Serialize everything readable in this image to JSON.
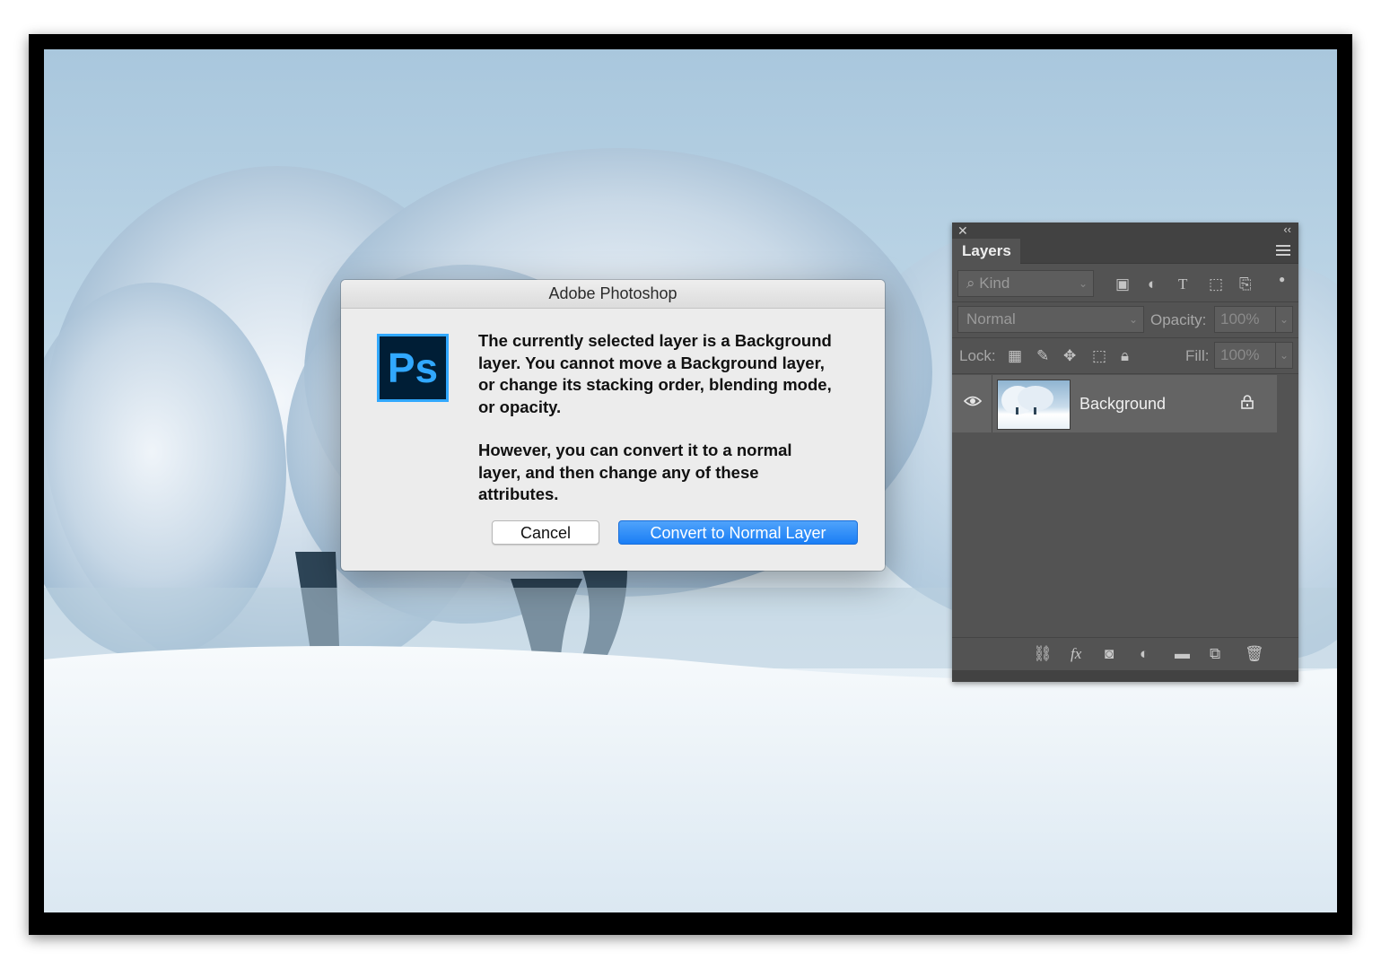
{
  "dialog": {
    "title": "Adobe Photoshop",
    "logo_text": "Ps",
    "message_1": "The currently selected layer is a Background layer. You cannot move a Background layer, or change its stacking order, blending mode, or opacity.",
    "message_2": "However, you can convert it to a normal layer, and then change any of these attributes.",
    "cancel_label": "Cancel",
    "convert_label": "Convert to Normal Layer"
  },
  "layers_panel": {
    "tab_label": "Layers",
    "kind_label": "Kind",
    "blend_mode": "Normal",
    "opacity_label": "Opacity:",
    "opacity_value": "100%",
    "lock_label": "Lock:",
    "fill_label": "Fill:",
    "fill_value": "100%",
    "layers": [
      {
        "name": "Background",
        "visible": true,
        "locked": true
      }
    ]
  },
  "colors": {
    "accent": "#1a7ef5",
    "ps_logo_blue": "#31a8ff",
    "ps_logo_bg": "#001e36",
    "panel_bg": "#535353"
  },
  "icons": [
    "close-icon",
    "collapse-icon",
    "panel-menu-icon",
    "search-icon",
    "filter-pixel-icon",
    "filter-adjustment-icon",
    "filter-type-icon",
    "filter-shape-icon",
    "filter-smart-object-icon",
    "filter-toggle-icon",
    "lock-transparent-icon",
    "lock-pixels-icon",
    "lock-position-icon",
    "lock-artboard-icon",
    "lock-all-icon",
    "eye-icon",
    "layer-lock-icon",
    "link-layers-icon",
    "fx-icon",
    "add-mask-icon",
    "adjustment-layer-icon",
    "new-group-icon",
    "new-layer-icon",
    "delete-layer-icon"
  ]
}
